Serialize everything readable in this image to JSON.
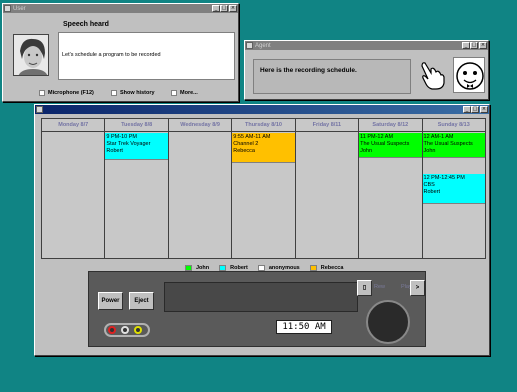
{
  "user_window": {
    "title": "User",
    "speech_heading": "Speech heard",
    "speech_text": "Let's schedule a program to be recorded",
    "checkboxes": [
      "Microphone (F12)",
      "Show history",
      "More..."
    ]
  },
  "agent_window": {
    "title": "Agent",
    "message": "Here is the recording schedule."
  },
  "schedule": {
    "days": [
      "Monday 8/7",
      "Tuesday 8/8",
      "Wednesday 8/9",
      "Thursday 8/10",
      "Friday 8/11",
      "Saturday 8/12",
      "Sunday 8/13"
    ],
    "events": {
      "tuesday": {
        "time": "9 PM-10 PM",
        "title": "Star Trek Voyager",
        "person": "Robert",
        "color": "#00ffff"
      },
      "thursday": {
        "time": "9:55 AM-11 AM",
        "title": "Channel 2",
        "person": "Rebecca",
        "color": "#ffc000"
      },
      "saturday": {
        "time": "11 PM-12 AM",
        "title": "The Usual Suspects",
        "person": "John",
        "color": "#00ff00"
      },
      "sunday_1": {
        "time": "12 AM-1 AM",
        "title": "The Usual Suspects",
        "person": "John",
        "color": "#00ff00"
      },
      "sunday_2": {
        "time": "12 PM-12:45 PM",
        "title": "CBS",
        "person": "Robert",
        "color": "#00ffff"
      }
    },
    "legend": [
      {
        "name": "John",
        "color": "#00ff00"
      },
      {
        "name": "Robert",
        "color": "#00ffff"
      },
      {
        "name": "anonymous",
        "color": "#ffffff"
      },
      {
        "name": "Rebecca",
        "color": "#ffc000"
      }
    ]
  },
  "vcr": {
    "power_label": "Power",
    "eject_label": "Eject",
    "stop_label": "▯",
    "rew_label": "Rew",
    "play_label": "Play",
    "ff_label": ">",
    "clock": "11:50 AM"
  }
}
